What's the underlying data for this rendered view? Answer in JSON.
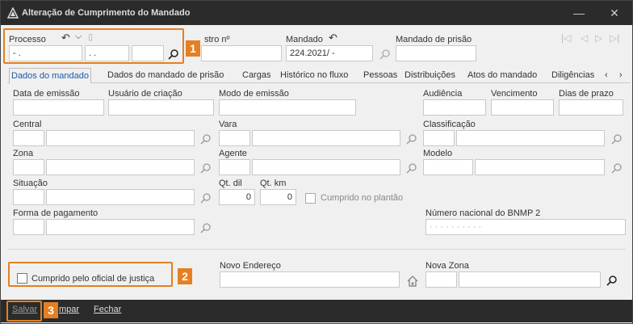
{
  "window": {
    "title": "Alteração de Cumprimento do Mandado"
  },
  "header": {
    "processo_label": "Processo",
    "processo_part1": "-    .",
    "processo_part2": ".     .",
    "processo_part3": "",
    "registro_label": "stro nº",
    "mandado_label": "Mandado",
    "mandado_value": "224.2021/       -",
    "mandado_prisao_label": "Mandado de prisão"
  },
  "tabs": [
    "Dados do mandado",
    "Dados do mandado de prisão",
    "Cargas",
    "Histórico no fluxo",
    "Pessoas",
    "Distribuições",
    "Atos do mandado",
    "Diligências"
  ],
  "form": {
    "data_emissao": "Data de emissão",
    "usuario_criacao": "Usuário de criação",
    "modo_emissao": "Modo de emissão",
    "audiencia": "Audiência",
    "vencimento": "Vencimento",
    "dias_prazo": "Dias de prazo",
    "central": "Central",
    "vara": "Vara",
    "classificacao": "Classificação",
    "zona": "Zona",
    "agente": "Agente",
    "modelo": "Modelo",
    "situacao": "Situação",
    "qt_dil": "Qt. dil",
    "qt_dil_value": "0",
    "qt_km": "Qt. km",
    "qt_km_value": "0",
    "cumprido_plantao": "Cumprido no plantão",
    "forma_pagamento": "Forma de pagamento",
    "numero_bnmp": "Número nacional do BNMP 2",
    "numero_bnmp_value": "· · · · · · · ·  ·  ·",
    "cumprido_oficial": "Cumprido pelo oficial de justiça",
    "novo_endereco": "Novo Endereço",
    "nova_zona": "Nova Zona"
  },
  "footer": {
    "salvar": "Salvar",
    "limpar": "mpar",
    "fechar": "Fechar"
  },
  "badges": [
    "1",
    "2",
    "3"
  ],
  "colors": {
    "highlight": "#e47f22",
    "titlebar": "#2b2b2b",
    "active_tab": "#1e5aa8"
  }
}
